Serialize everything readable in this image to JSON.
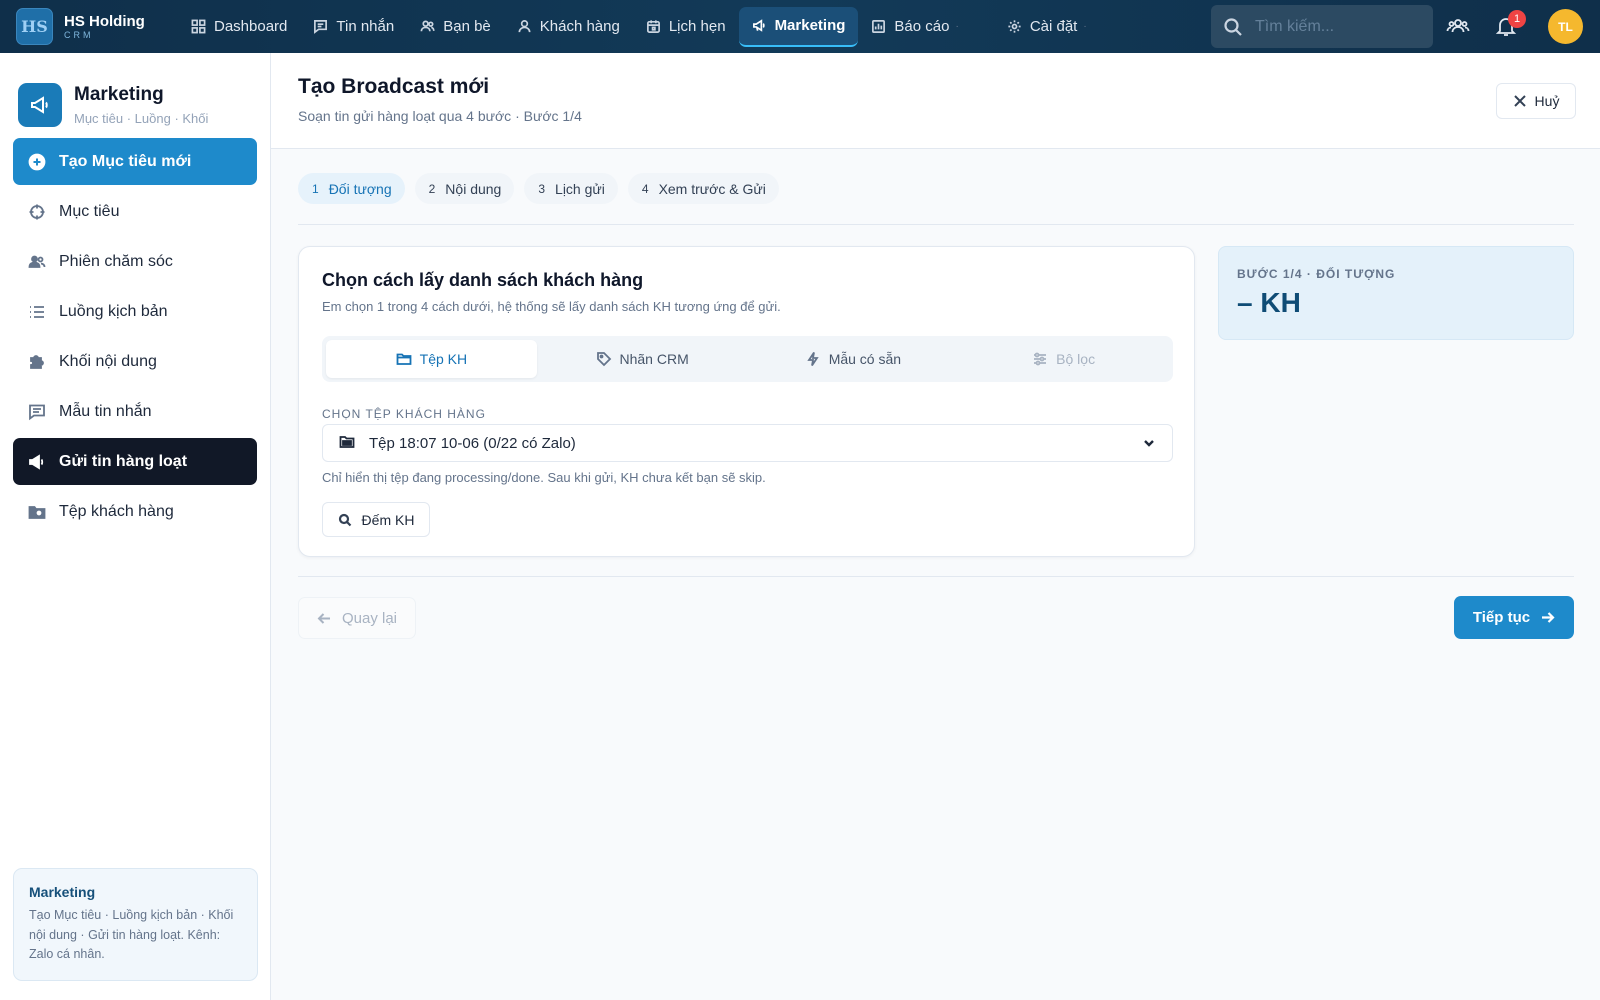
{
  "brand": {
    "name": "HS Holding",
    "sub": "CRM",
    "logo_text": "HS"
  },
  "nav": [
    {
      "label": "Dashboard",
      "icon": "grid-icon"
    },
    {
      "label": "Tin nhắn",
      "icon": "message-icon"
    },
    {
      "label": "Bạn bè",
      "icon": "friends-icon"
    },
    {
      "label": "Khách hàng",
      "icon": "user-icon"
    },
    {
      "label": "Lịch hẹn",
      "icon": "calendar-icon"
    },
    {
      "label": "Marketing",
      "icon": "megaphone-icon",
      "active": true
    },
    {
      "label": "Báo cáo",
      "icon": "chart-icon"
    },
    {
      "label": "Cài đặt",
      "icon": "gear-icon"
    }
  ],
  "search": {
    "placeholder": "Tìm kiếm..."
  },
  "notifications": {
    "count": "1"
  },
  "avatar": {
    "initials": "TL"
  },
  "sidebar": {
    "title": "Marketing",
    "subtitle": "Mục tiêu · Luồng · Khối",
    "items": [
      {
        "label": "Tạo Mục tiêu mới",
        "icon": "plus-circle-icon"
      },
      {
        "label": "Mục tiêu",
        "icon": "crosshair-icon"
      },
      {
        "label": "Phiên chăm sóc",
        "icon": "users-care-icon"
      },
      {
        "label": "Luồng kịch bản",
        "icon": "list-icon"
      },
      {
        "label": "Khối nội dung",
        "icon": "puzzle-icon"
      },
      {
        "label": "Mẫu tin nhắn",
        "icon": "message-template-icon"
      },
      {
        "label": "Gửi tin hàng loạt",
        "icon": "broadcast-icon"
      },
      {
        "label": "Tệp khách hàng",
        "icon": "folder-user-icon"
      }
    ],
    "note": {
      "heading": "Marketing",
      "body": "Tạo Mục tiêu · Luồng kịch bản · Khối nội dung · Gửi tin hàng loạt. Kênh: Zalo cá nhân."
    }
  },
  "page": {
    "title": "Tạo Broadcast mới",
    "subtitle": "Soạn tin gửi hàng loạt qua 4 bước · Bước 1/4",
    "cancel_label": "Huỷ"
  },
  "steps": [
    {
      "num": "1",
      "label": "Đối tượng",
      "active": true
    },
    {
      "num": "2",
      "label": "Nội dung"
    },
    {
      "num": "3",
      "label": "Lịch gửi"
    },
    {
      "num": "4",
      "label": "Xem trước & Gửi"
    }
  ],
  "card": {
    "title": "Chọn cách lấy danh sách khách hàng",
    "subtitle": "Em chọn 1 trong 4 cách dưới, hệ thống sẽ lấy danh sách KH tương ứng để gửi.",
    "tabs": [
      {
        "label": "Tệp KH",
        "icon": "folder-icon",
        "active": true
      },
      {
        "label": "Nhãn CRM",
        "icon": "tag-icon"
      },
      {
        "label": "Mẫu có sẵn",
        "icon": "bolt-icon"
      },
      {
        "label": "Bộ lọc",
        "icon": "sliders-icon",
        "disabled": true
      }
    ],
    "field_label": "CHỌN TỆP KHÁCH HÀNG",
    "select_value": "Tệp 18:07 10-06 (0/22 có Zalo)",
    "hint": "Chỉ hiển thị tệp đang processing/done. Sau khi gửi, KH chưa kết bạn sẽ skip.",
    "count_label": "Đếm KH"
  },
  "summary": {
    "label": "BƯỚC 1/4 · ĐỐI TƯỢNG",
    "value": "– KH"
  },
  "footer": {
    "back_label": "Quay lại",
    "next_label": "Tiếp tục"
  },
  "colors": {
    "accent": "#1e8acb",
    "topbar": "#0f2f4a",
    "active_dark": "#111827"
  }
}
